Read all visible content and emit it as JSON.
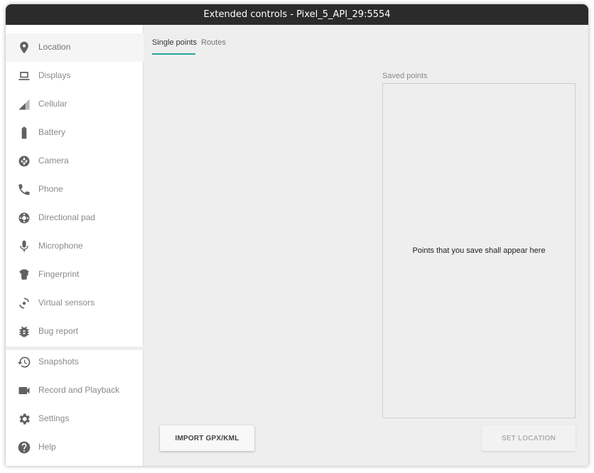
{
  "window": {
    "title": "Extended controls - Pixel_5_API_29:5554"
  },
  "sidebar": {
    "items": [
      {
        "label": "Location",
        "icon": "location-pin-icon",
        "active": true
      },
      {
        "label": "Displays",
        "icon": "display-icon"
      },
      {
        "label": "Cellular",
        "icon": "signal-icon"
      },
      {
        "label": "Battery",
        "icon": "battery-icon"
      },
      {
        "label": "Camera",
        "icon": "camera-aperture-icon"
      },
      {
        "label": "Phone",
        "icon": "phone-icon"
      },
      {
        "label": "Directional pad",
        "icon": "dpad-icon"
      },
      {
        "label": "Microphone",
        "icon": "microphone-icon"
      },
      {
        "label": "Fingerprint",
        "icon": "fingerprint-icon"
      },
      {
        "label": "Virtual sensors",
        "icon": "rotation-icon"
      },
      {
        "label": "Bug report",
        "icon": "bug-icon"
      },
      {
        "label": "Snapshots",
        "icon": "history-icon"
      },
      {
        "label": "Record and Playback",
        "icon": "videocam-icon"
      },
      {
        "label": "Settings",
        "icon": "gear-icon"
      },
      {
        "label": "Help",
        "icon": "help-icon"
      }
    ]
  },
  "tabs": [
    {
      "label": "Single points",
      "active": true
    },
    {
      "label": "Routes",
      "active": false
    }
  ],
  "saved_points": {
    "label": "Saved points",
    "empty_message": "Points that you save shall appear here"
  },
  "buttons": {
    "import": "IMPORT GPX/KML",
    "set_location": "SET LOCATION"
  },
  "colors": {
    "accent": "#26a69a",
    "titlebar": "#2b2b2b",
    "icon": "#616161"
  }
}
